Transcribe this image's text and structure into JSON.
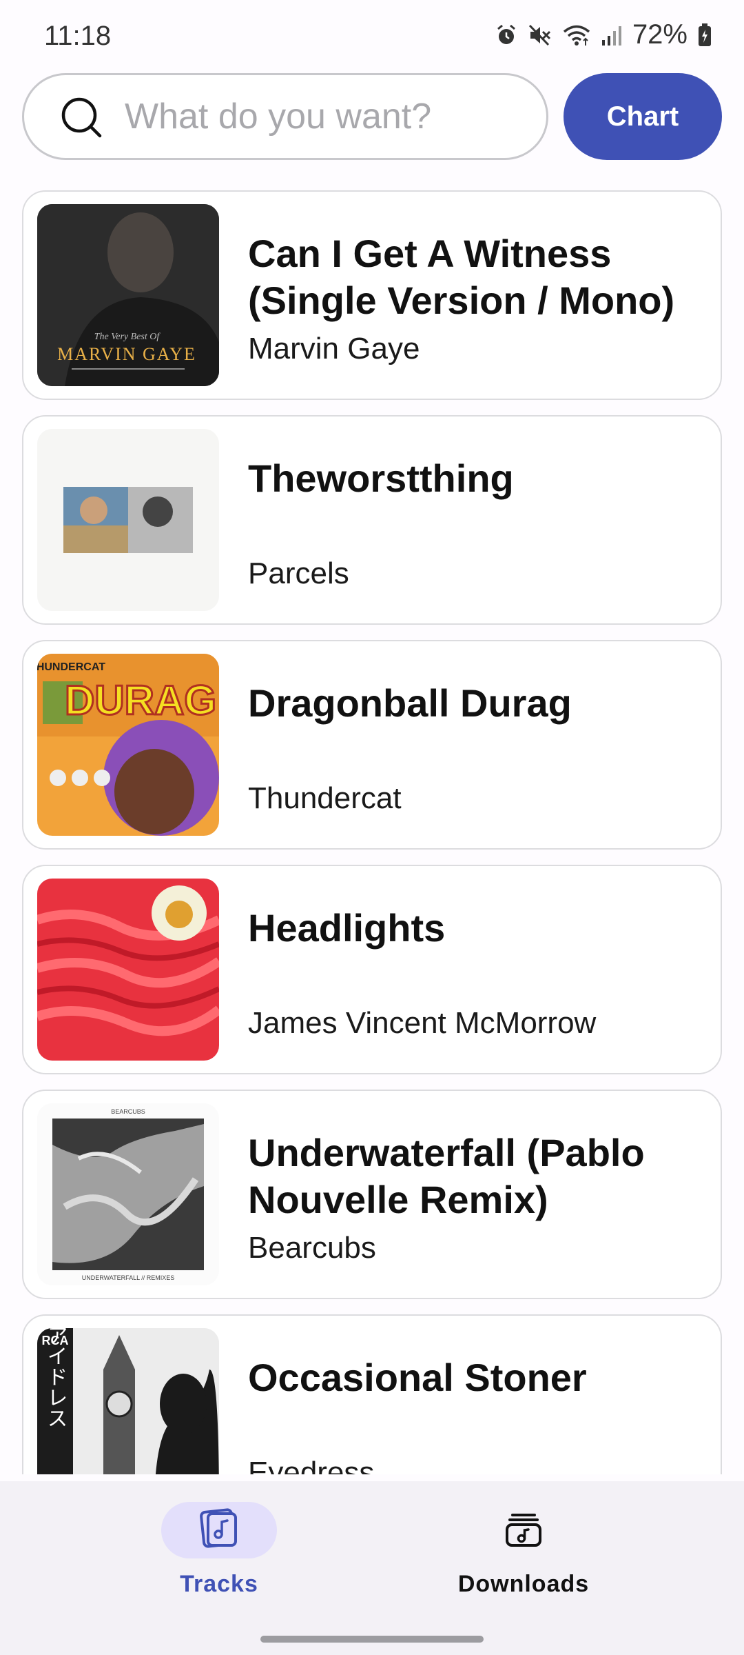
{
  "status_bar": {
    "time": "11:18",
    "battery": "72%",
    "icons": [
      "alarm-icon",
      "mute-icon",
      "wifi-icon",
      "signal-icon",
      "battery-icon"
    ]
  },
  "search": {
    "placeholder": "What do you want?",
    "value": "",
    "icon": "search-icon"
  },
  "chart_button": {
    "label": "Chart",
    "color": "#3f51b5"
  },
  "tracks": [
    {
      "title": "Can I Get A Witness (Single Version / Mono)",
      "artist": "Marvin Gaye",
      "cover": {
        "line1": "The Very Best Of",
        "line2": "MARVIN GAYE"
      }
    },
    {
      "title": "Theworstthing",
      "artist": "Parcels",
      "cover": {}
    },
    {
      "title": "Dragonball Durag",
      "artist": "Thundercat",
      "cover": {
        "text": "DURAG",
        "small": "THUNDERCAT"
      }
    },
    {
      "title": "Headlights",
      "artist": "James Vincent McMorrow",
      "cover": {}
    },
    {
      "title": "Underwaterfall (Pablo Nouvelle Remix)",
      "artist": "Bearcubs",
      "cover": {
        "top": "BEARCUBS",
        "bottom": "UNDERWATERFALL // REMIXES"
      }
    },
    {
      "title": "Occasional Stoner",
      "artist": "Eyedress",
      "cover": {
        "logo": "RCA",
        "vertical": "アイドレス"
      }
    }
  ],
  "bottom_nav": {
    "items": [
      {
        "label": "Tracks",
        "icon": "music-library-icon",
        "active": true
      },
      {
        "label": "Downloads",
        "icon": "downloads-music-icon",
        "active": false
      }
    ],
    "active_color": "#3f51b5",
    "active_pill_color": "#e3dffb"
  }
}
